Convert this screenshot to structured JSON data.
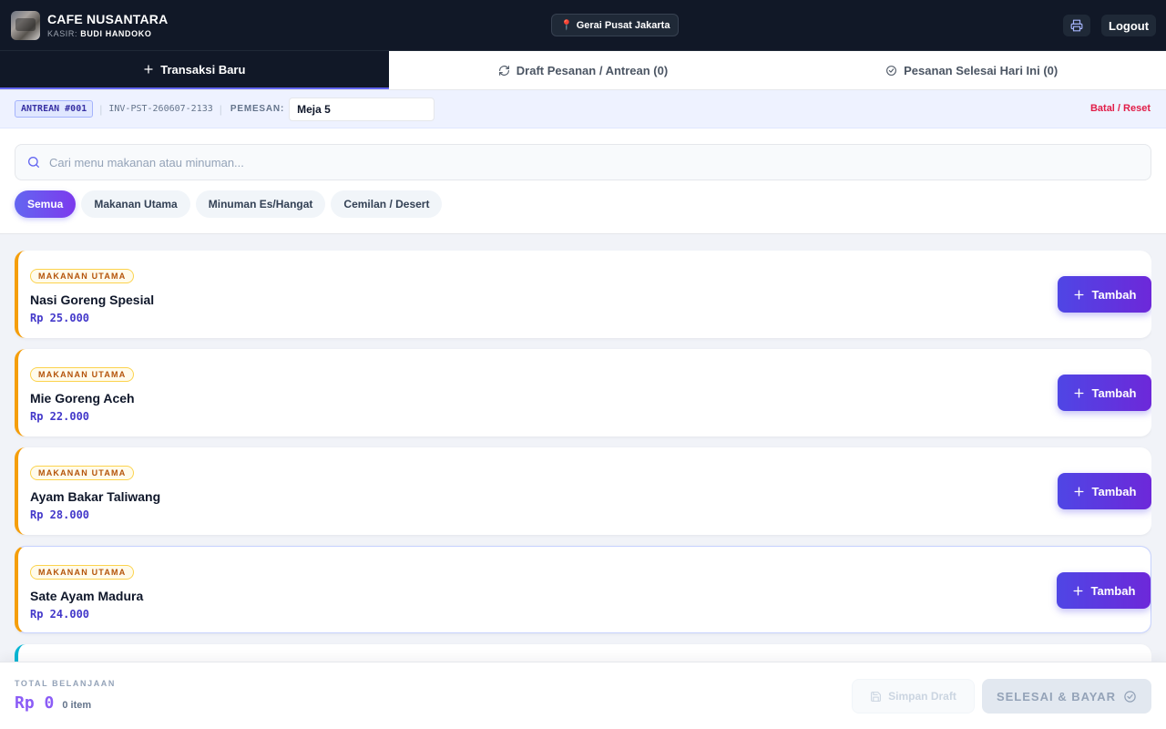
{
  "header": {
    "app_name": "CAFE NUSANTARA",
    "cashier_label": "KASIR:",
    "cashier_name": "BUDI HANDOKO",
    "branch": "Gerai Pusat Jakarta",
    "logout_label": "Logout"
  },
  "tabs": [
    {
      "label": "Transaksi Baru",
      "icon": "plus-icon",
      "active": true
    },
    {
      "label": "Draft Pesanan / Antrean (0)",
      "icon": "refresh-icon",
      "active": false
    },
    {
      "label": "Pesanan Selesai Hari Ini (0)",
      "icon": "check-circle-icon",
      "active": false
    }
  ],
  "order": {
    "queue": "ANTREAN #001",
    "invoice": "INV-PST-260607-2133",
    "customer_label": "PEMESAN:",
    "customer_value": "Meja 5",
    "reset_label": "Batal / Reset"
  },
  "search": {
    "placeholder": "Cari menu makanan atau minuman...",
    "value": ""
  },
  "categories": [
    {
      "label": "Semua",
      "active": true
    },
    {
      "label": "Makanan Utama",
      "active": false
    },
    {
      "label": "Minuman Es/Hangat",
      "active": false
    },
    {
      "label": "Cemilan / Desert",
      "active": false
    }
  ],
  "menu_items": [
    {
      "category": "MAKANAN UTAMA",
      "name": "Nasi Goreng Spesial",
      "price": "Rp 25.000"
    },
    {
      "category": "MAKANAN UTAMA",
      "name": "Mie Goreng Aceh",
      "price": "Rp 22.000"
    },
    {
      "category": "MAKANAN UTAMA",
      "name": "Ayam Bakar Taliwang",
      "price": "Rp 28.000"
    },
    {
      "category": "MAKANAN UTAMA",
      "name": "Sate Ayam Madura",
      "price": "Rp 24.000"
    }
  ],
  "add_label": "Tambah",
  "footer": {
    "total_label": "TOTAL BELANJAAN",
    "total_value": "Rp 0",
    "item_count": "0 item",
    "save_draft_label": "Simpan Draft",
    "pay_label": "SELESAI & BAYAR"
  },
  "colors": {
    "primary": "#4f46e5",
    "header_bg": "#111827",
    "category_accent": "#f59e0b",
    "danger": "#e11d48"
  }
}
